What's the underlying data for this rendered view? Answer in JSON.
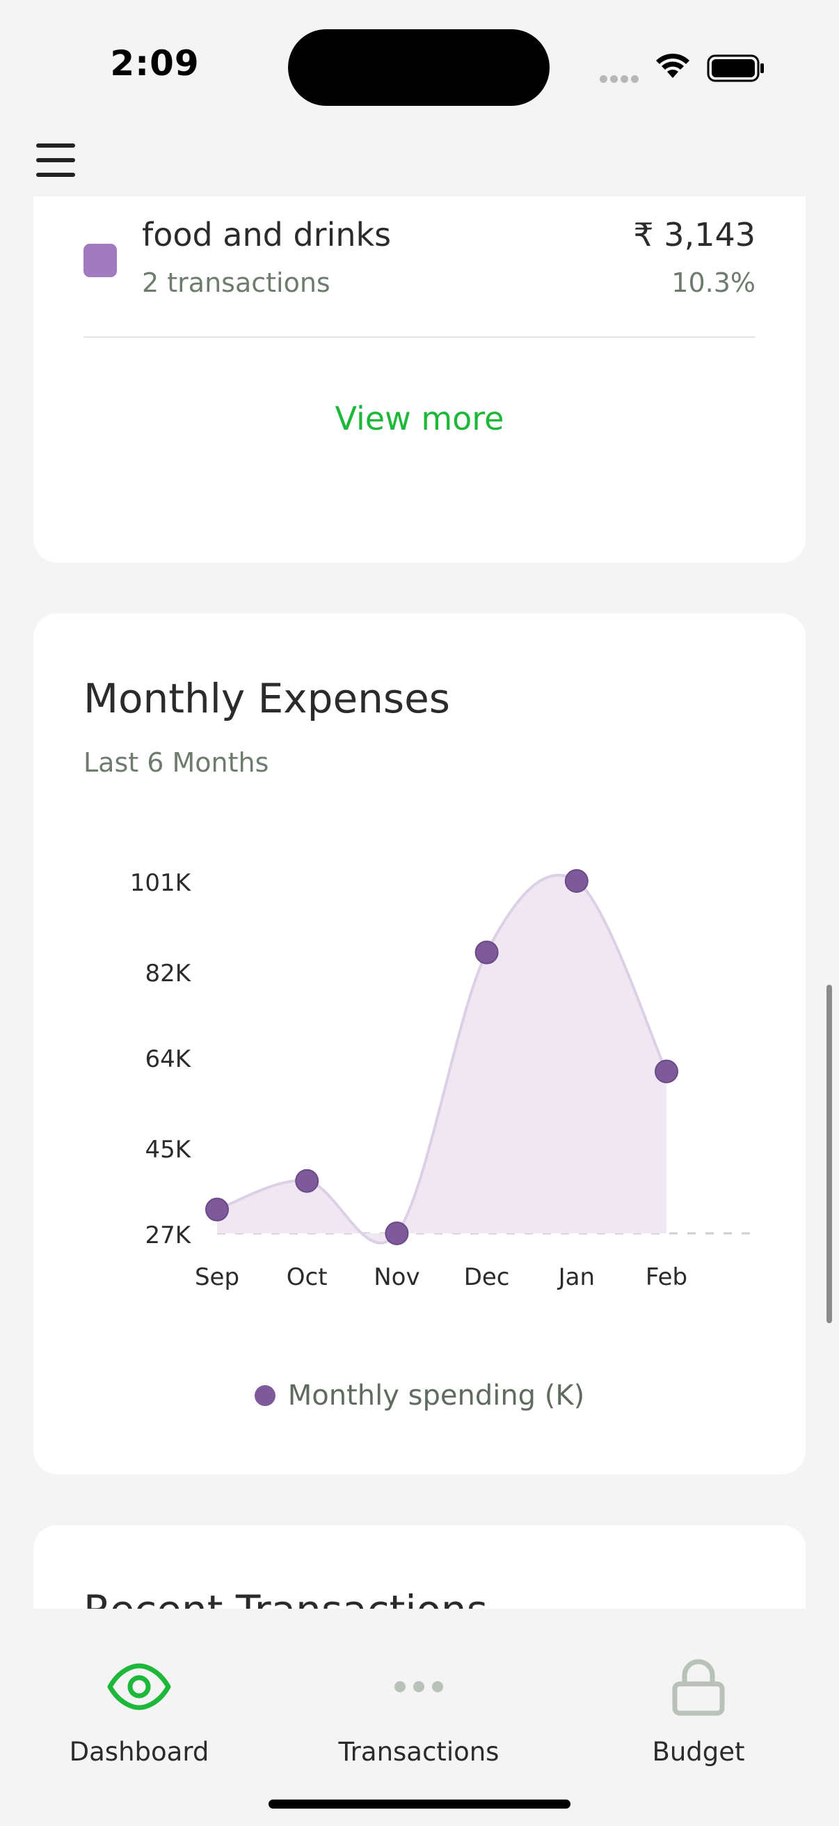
{
  "status_bar": {
    "time": "2:09"
  },
  "header": {
    "menu_icon": "hamburger-menu-icon"
  },
  "categories_card": {
    "item": {
      "name": "food and drinks",
      "transactions": "2 transactions",
      "amount": "₹ 3,143",
      "percent": "10.3%",
      "color": "#a27abf"
    },
    "view_more": "View more"
  },
  "monthly_expenses": {
    "title": "Monthly Expenses",
    "subtitle": "Last 6 Months",
    "legend": "Monthly spending (K)"
  },
  "chart_data": {
    "type": "area",
    "categories": [
      "Sep",
      "Oct",
      "Nov",
      "Dec",
      "Jan",
      "Feb"
    ],
    "series": [
      {
        "name": "Monthly spending (K)",
        "values": [
          32,
          38,
          27,
          86,
          101,
          61
        ],
        "color": "#7e5a9b"
      }
    ],
    "y_ticks": [
      "101K",
      "82K",
      "64K",
      "45K",
      "27K"
    ],
    "y_tick_values": [
      101,
      82,
      64,
      45,
      27
    ],
    "ylim": [
      27,
      101
    ],
    "legend_position": "bottom"
  },
  "recent": {
    "title": "Recent Transactions"
  },
  "tabs": [
    {
      "label": "Dashboard",
      "icon": "eye-icon",
      "active": true
    },
    {
      "label": "Transactions",
      "icon": "more-dots-icon",
      "active": false
    },
    {
      "label": "Budget",
      "icon": "lock-icon",
      "active": false
    }
  ],
  "colors": {
    "accent": "#1db83a",
    "chart": "#7e5a9b",
    "muted": "#6d7c6d"
  }
}
